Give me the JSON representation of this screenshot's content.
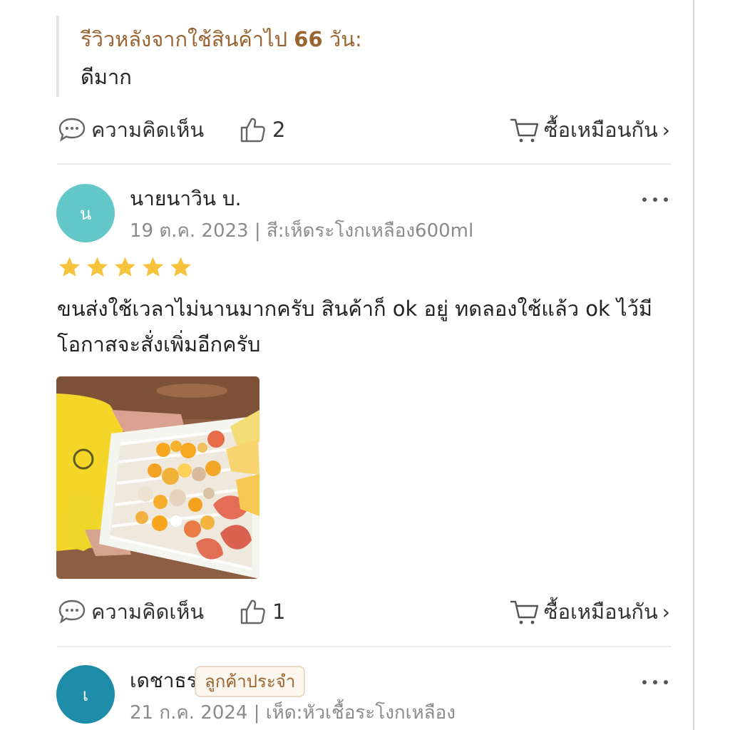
{
  "followup": {
    "heading_prefix": "รีวิวหลังจากใช้สินค้าไป",
    "days": "66",
    "heading_suffix": "วัน:",
    "body": "ดีมาก"
  },
  "actions": {
    "comment_label": "ความคิดเห็น",
    "buy_label": "ซื้อเหมือนกัน",
    "chevron": "›"
  },
  "reviews": [
    {
      "avatar_letter": "น",
      "avatar_color": "#63c7c8",
      "name": "นายนาวิน บ.",
      "date": "19 ต.ค. 2023",
      "variant": "สี:เห็ดระโงกเหลือง600ml",
      "rating": 5,
      "text": "ขนส่งใช้เวลาไม่นานมากครับ สินค้าก็ ok อยู่ ทดลองใช้แล้ว ok ไว้มีโอกาสจะสั่งเพิ่มอีกครับ",
      "likes": "1",
      "has_photo": true
    },
    {
      "avatar_letter": "เ",
      "avatar_color": "#1f8da9",
      "name": "เดชาธร",
      "badge": "ลูกค้าประจำ",
      "date": "21 ก.ค. 2024",
      "variant": "เห็ด:หัวเชื้อระโงกเหลือง"
    }
  ],
  "previous_review": {
    "likes": "2"
  },
  "colors": {
    "accent_brown": "#9a6431",
    "star_yellow": "#f7c33d",
    "muted_gray": "#8b8b8b"
  },
  "icons": [
    "comment-icon",
    "thumbs-up-icon",
    "cart-icon",
    "more-dots-icon",
    "star-icon",
    "chevron-right-icon"
  ]
}
